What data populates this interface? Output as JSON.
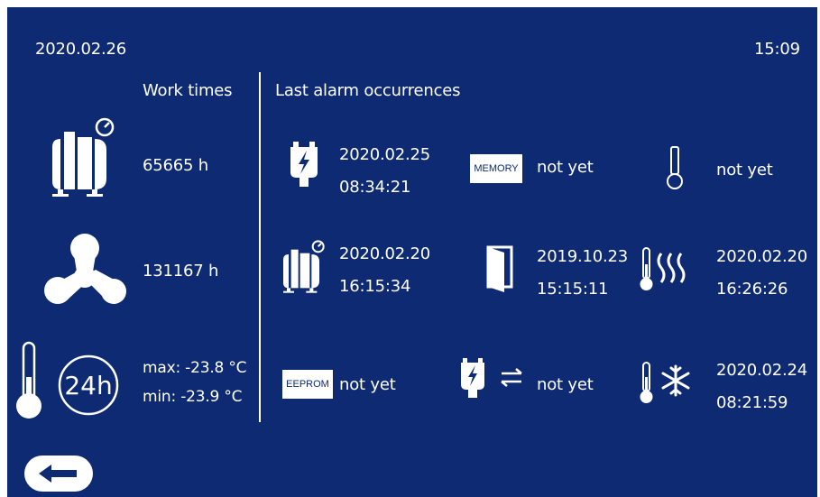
{
  "header": {
    "date": "2020.02.26",
    "time": "15:09"
  },
  "work_times": {
    "title": "Work times",
    "compressor_hours": "65665 h",
    "fan_hours": "131167 h",
    "temp_24h_badge": "24h",
    "temp_max": "max: -23.8 °C",
    "temp_min": "min: -23.9 °C"
  },
  "alarms": {
    "title": "Last alarm occurrences",
    "power": {
      "line1": "2020.02.25",
      "line2": "08:34:21"
    },
    "memory": {
      "chip": "MEMORY",
      "value": "not yet"
    },
    "sensor": {
      "value": "not yet"
    },
    "compressor": {
      "line1": "2020.02.20",
      "line2": "16:15:34"
    },
    "door": {
      "line1": "2019.10.23",
      "line2": "15:15:11"
    },
    "high_temp": {
      "line1": "2020.02.20",
      "line2": "16:26:26"
    },
    "eeprom": {
      "chip": "EEPROM",
      "value": "not yet"
    },
    "communication": {
      "value": "not yet"
    },
    "low_temp": {
      "line1": "2020.02.24",
      "line2": "08:21:59"
    }
  },
  "colors": {
    "background": "#0d2a73",
    "foreground": "#ffffff"
  }
}
